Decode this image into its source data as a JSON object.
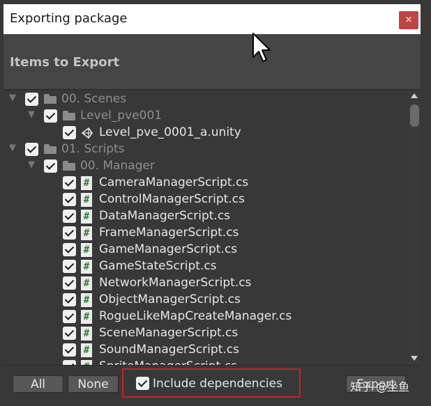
{
  "window": {
    "title": "Exporting package",
    "close_glyph": "×"
  },
  "header": {
    "title": "Items to Export"
  },
  "tree": [
    {
      "label": "00. Scenes",
      "type": "folder",
      "level": 0,
      "expanded": true,
      "checked": true
    },
    {
      "label": "Level_pve001",
      "type": "folder",
      "level": 1,
      "expanded": true,
      "checked": true
    },
    {
      "label": "Level_pve_0001_a.unity",
      "type": "unity-scene",
      "level": 2,
      "checked": true
    },
    {
      "label": "01. Scripts",
      "type": "folder",
      "level": 0,
      "expanded": true,
      "checked": true
    },
    {
      "label": "00. Manager",
      "type": "folder",
      "level": 1,
      "expanded": true,
      "checked": true
    },
    {
      "label": "CameraManagerScript.cs",
      "type": "cs-script",
      "level": 2,
      "checked": true
    },
    {
      "label": "ControlManagerScript.cs",
      "type": "cs-script",
      "level": 2,
      "checked": true
    },
    {
      "label": "DataManagerScript.cs",
      "type": "cs-script",
      "level": 2,
      "checked": true
    },
    {
      "label": "FrameManagerScript.cs",
      "type": "cs-script",
      "level": 2,
      "checked": true
    },
    {
      "label": "GameManagerScript.cs",
      "type": "cs-script",
      "level": 2,
      "checked": true
    },
    {
      "label": "GameStateScript.cs",
      "type": "cs-script",
      "level": 2,
      "checked": true
    },
    {
      "label": "NetworkManagerScript.cs",
      "type": "cs-script",
      "level": 2,
      "checked": true
    },
    {
      "label": "ObjectManagerScript.cs",
      "type": "cs-script",
      "level": 2,
      "checked": true
    },
    {
      "label": "RogueLikeMapCreateManager.cs",
      "type": "cs-script",
      "level": 2,
      "checked": true
    },
    {
      "label": "SceneManagerScript.cs",
      "type": "cs-script",
      "level": 2,
      "checked": true
    },
    {
      "label": "SoundManagerScript.cs",
      "type": "cs-script",
      "level": 2,
      "checked": true
    },
    {
      "label": "SpriteManagerScript.cs",
      "type": "cs-script",
      "level": 2,
      "checked": true
    }
  ],
  "footer": {
    "all_label": "All",
    "none_label": "None",
    "include_dependencies_label": "Include dependencies",
    "include_dependencies_checked": true,
    "export_label": "Export"
  },
  "watermark": "知乎 @坐鱼",
  "colors": {
    "close_button": "#c14343",
    "highlight_box": "#c12626",
    "script_icon": "#2e7d32"
  }
}
